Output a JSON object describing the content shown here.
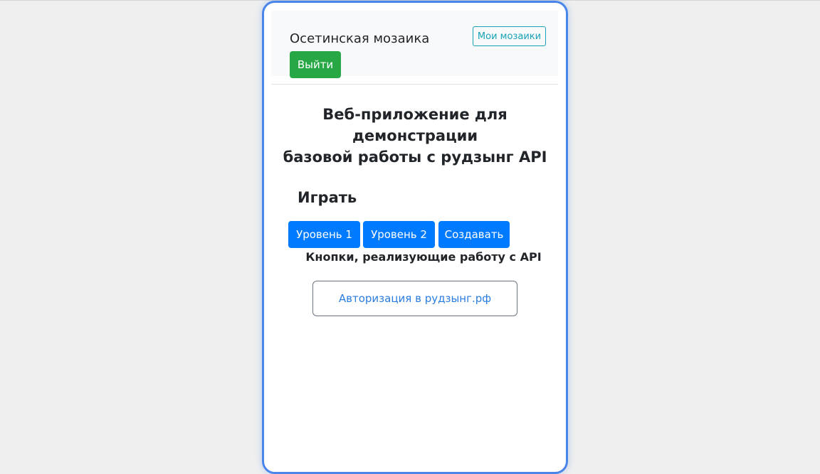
{
  "navbar": {
    "brand": "Осетинская мозаика",
    "my_mosaics_label": "Мои мозаики",
    "exit_label": "Выйти"
  },
  "main": {
    "title_lines": [
      "Веб-приложение для",
      "демонстрации",
      "базовой работы с рудзынг API"
    ],
    "play_heading": "Играть",
    "buttons": {
      "level1": "Уровень 1",
      "level2": "Уровень 2",
      "create": "Создавать"
    },
    "caption": "Кнопки, реализующие работу с API",
    "auth_label": "Авторизация в рудзынг.рф"
  },
  "colors": {
    "background": "#efefef",
    "frame_border": "#4a86ea",
    "navbar_bg": "#f8f9fa",
    "outline_info": "#17a2b8",
    "success": "#28a745",
    "primary": "#007bff",
    "auth_text": "#2a7de0",
    "auth_border": "#6c757d"
  }
}
